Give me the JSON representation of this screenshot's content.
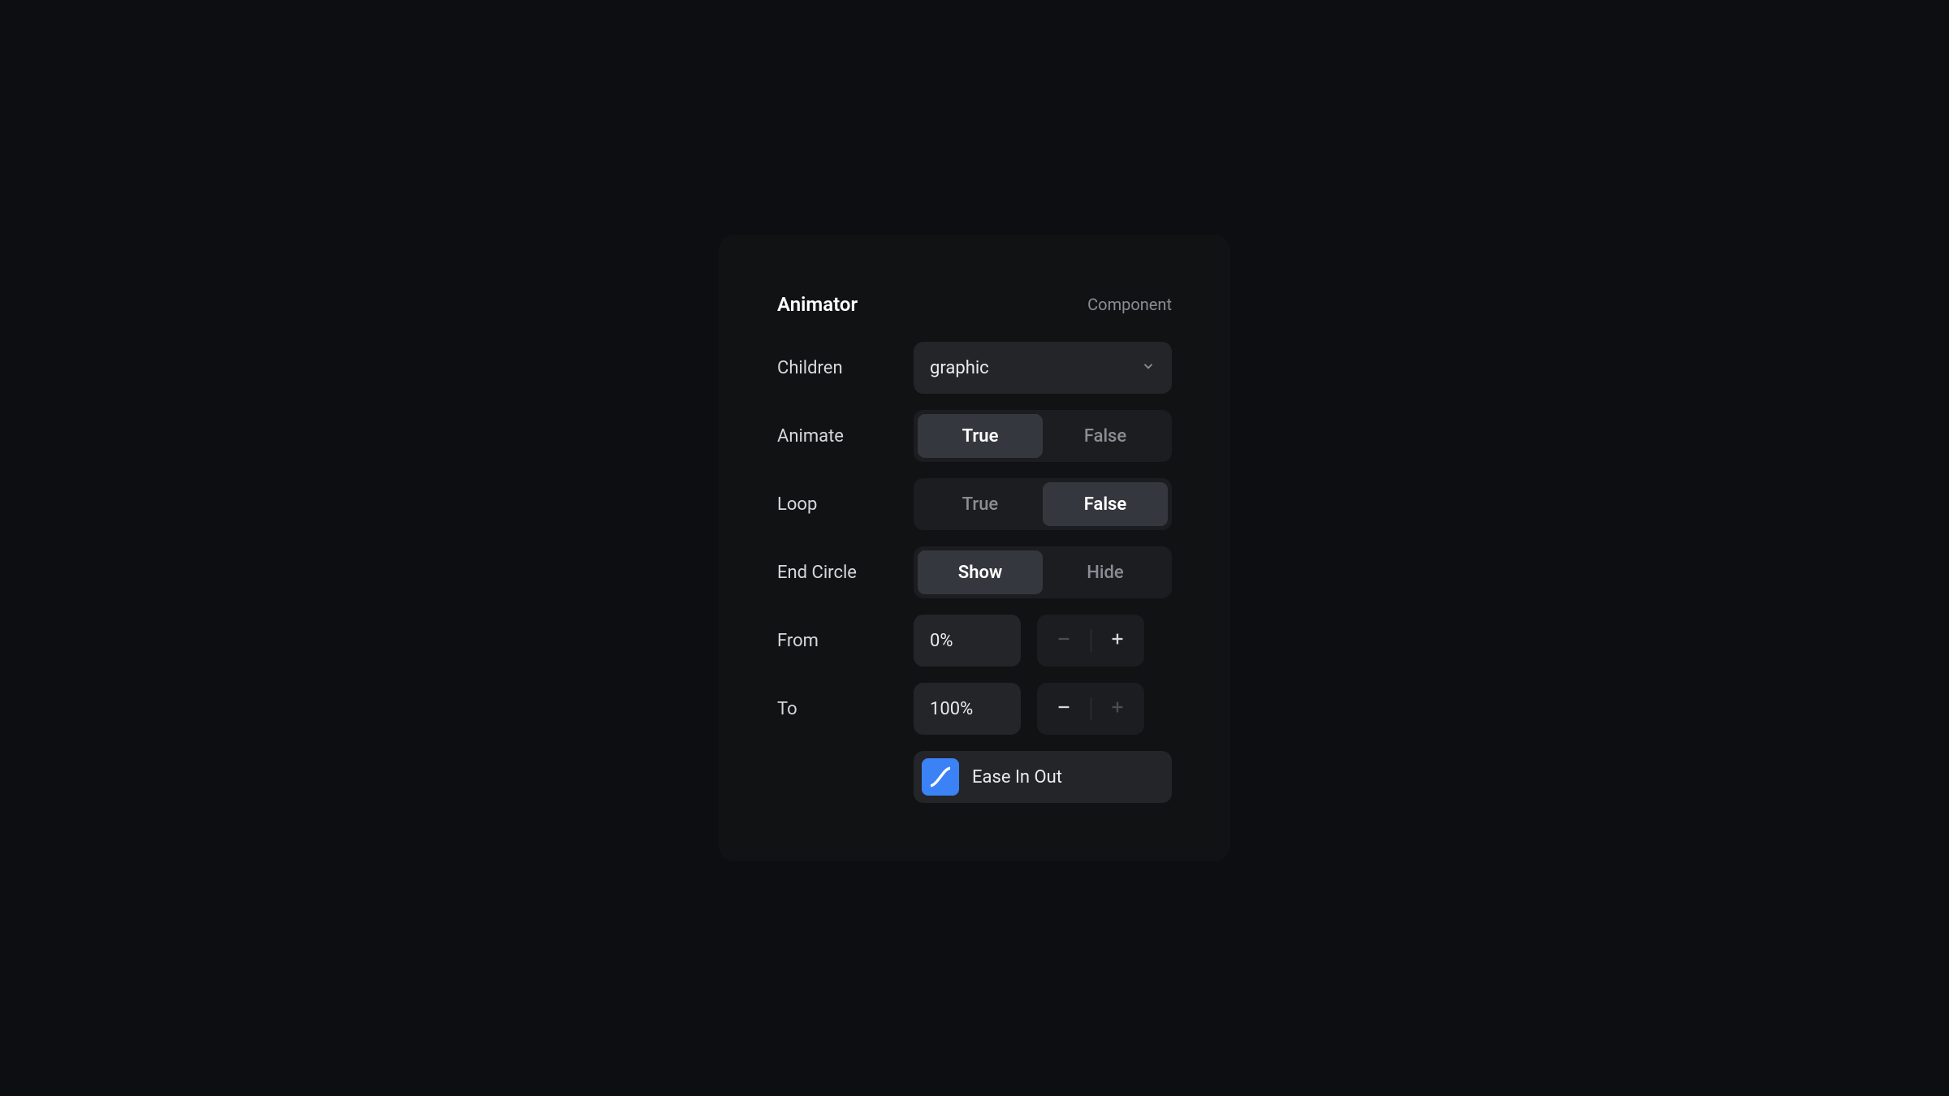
{
  "panel": {
    "title": "Animator",
    "tag": "Component"
  },
  "children": {
    "label": "Children",
    "value": "graphic"
  },
  "animate": {
    "label": "Animate",
    "options": {
      "true": "True",
      "false": "False"
    },
    "selected": "true"
  },
  "loop": {
    "label": "Loop",
    "options": {
      "true": "True",
      "false": "False"
    },
    "selected": "false"
  },
  "endCircle": {
    "label": "End Circle",
    "options": {
      "show": "Show",
      "hide": "Hide"
    },
    "selected": "show"
  },
  "from": {
    "label": "From",
    "value": "0%",
    "canDecrement": false,
    "canIncrement": true
  },
  "to": {
    "label": "To",
    "value": "100%",
    "canDecrement": true,
    "canIncrement": false
  },
  "easing": {
    "label": "Ease In Out"
  }
}
